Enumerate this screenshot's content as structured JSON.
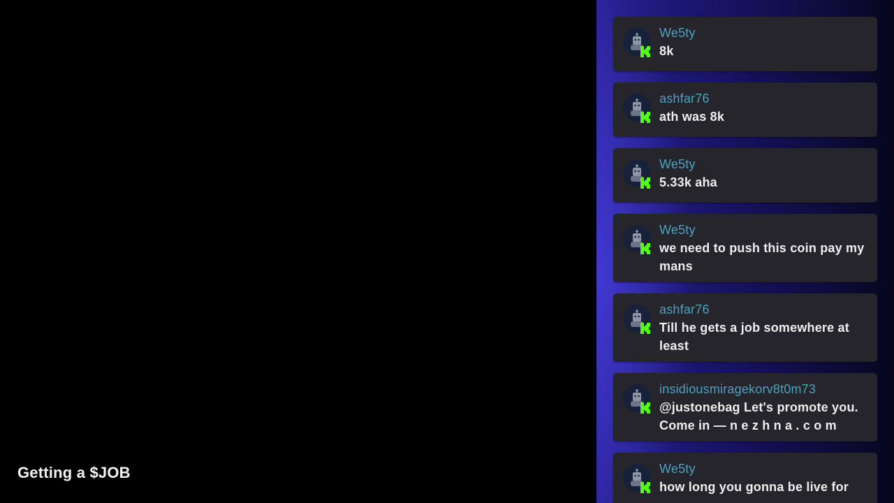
{
  "stream": {
    "title": "Getting a $JOB"
  },
  "colors": {
    "username": "#4aa3c2",
    "message_text": "#eeeeee",
    "badge": "#53fc18",
    "card_bg": "#25252b"
  },
  "chat": {
    "messages": [
      {
        "username": "We5ty",
        "text": "8k",
        "avatar_icon": "default-avatar-icon",
        "badge_icon": "kick-k-badge-icon"
      },
      {
        "username": "ashfar76",
        "text": "ath was 8k",
        "avatar_icon": "default-avatar-icon",
        "badge_icon": "kick-k-badge-icon"
      },
      {
        "username": "We5ty",
        "text": "5.33k aha",
        "avatar_icon": "default-avatar-icon",
        "badge_icon": "kick-k-badge-icon"
      },
      {
        "username": "We5ty",
        "text": "we need to push this coin pay my mans",
        "avatar_icon": "default-avatar-icon",
        "badge_icon": "kick-k-badge-icon"
      },
      {
        "username": "ashfar76",
        "text": "Till he gets a job somewhere at least",
        "avatar_icon": "default-avatar-icon",
        "badge_icon": "kick-k-badge-icon"
      },
      {
        "username": "insidiousmiragekorv8t0m73",
        "text": "@justonebag Let's promote you. Come in — n e z h n a . c o  m",
        "avatar_icon": "default-avatar-icon",
        "badge_icon": "kick-k-badge-icon"
      },
      {
        "username": "We5ty",
        "text": "how long you gonna be live for",
        "avatar_icon": "default-avatar-icon",
        "badge_icon": "kick-k-badge-icon"
      }
    ]
  }
}
